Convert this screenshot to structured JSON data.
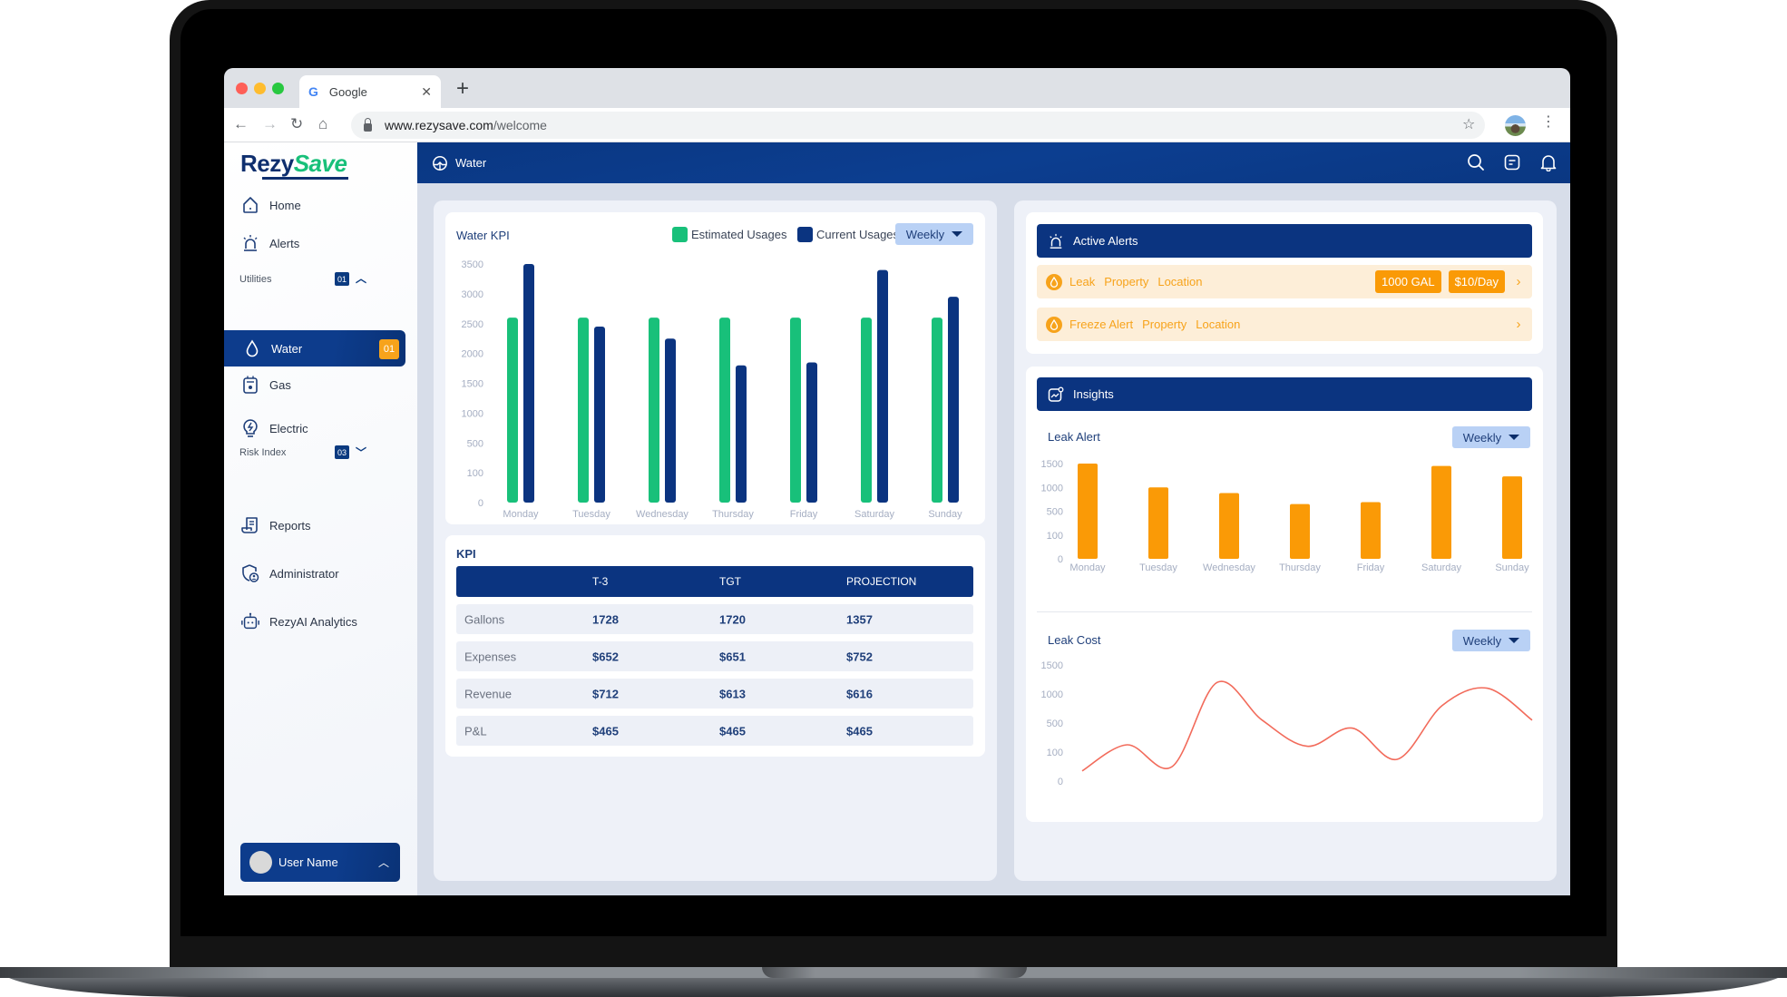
{
  "browser": {
    "tab_title": "Google",
    "tab_favicon": "G",
    "url_host": "www.rezysave.com",
    "url_path": "/welcome"
  },
  "logo": {
    "part1": "Rezy",
    "part2": "Save"
  },
  "sidebar": {
    "items_top": [
      {
        "label": "Home",
        "icon": "home-icon"
      },
      {
        "label": "Alerts",
        "icon": "siren-icon"
      }
    ],
    "utilities": {
      "label": "Utilities",
      "count": "01",
      "items": [
        {
          "label": "Water",
          "icon": "water-drop-icon",
          "badge": "01",
          "active": true
        },
        {
          "label": "Gas",
          "icon": "gas-meter-icon"
        },
        {
          "label": "Electric",
          "icon": "electric-bulb-icon"
        }
      ]
    },
    "risk_index": {
      "label": "Risk Index",
      "count": "03",
      "items": [
        {
          "label": "Reports",
          "icon": "report-icon"
        },
        {
          "label": "Administrator",
          "icon": "admin-shield-icon"
        },
        {
          "label": "RezyAI Analytics",
          "icon": "robot-icon"
        }
      ]
    },
    "user": {
      "name": "User Name"
    }
  },
  "topbar": {
    "title": "Water"
  },
  "water_kpi": {
    "title": "Water KPI",
    "dropdown": "Weekly"
  },
  "kpi_table": {
    "title": "KPI",
    "columns": [
      "",
      "T-3",
      "TGT",
      "PROJECTION"
    ],
    "rows": [
      [
        "Gallons",
        "1728",
        "1720",
        "1357"
      ],
      [
        "Expenses",
        "$652",
        "$651",
        "$752"
      ],
      [
        "Revenue",
        "$712",
        "$613",
        "$616"
      ],
      [
        "P&L",
        "$465",
        "$465",
        "$465"
      ]
    ]
  },
  "active_alerts": {
    "title": "Active Alerts",
    "items": [
      {
        "type": "Leak",
        "property": "Property",
        "location": "Location",
        "pills": [
          "1000 GAL",
          "$10/Day"
        ]
      },
      {
        "type": "Freeze Alert",
        "property": "Property",
        "location": "Location",
        "pills": []
      }
    ]
  },
  "insights": {
    "title": "Insights",
    "leak_alert": {
      "title": "Leak Alert",
      "dropdown": "Weekly"
    },
    "leak_cost": {
      "title": "Leak Cost",
      "dropdown": "Weekly"
    }
  },
  "colors": {
    "navy": "#0b3480",
    "green": "#18c07a",
    "orange": "#fa9a06",
    "line_red": "#f26b5b",
    "alert_bg": "#fdeed8"
  },
  "chart_data": [
    {
      "id": "water-kpi",
      "type": "bar",
      "title": "Water KPI",
      "categories": [
        "Monday",
        "Tuesday",
        "Wednesday",
        "Thursday",
        "Friday",
        "Saturday",
        "Sunday"
      ],
      "series": [
        {
          "name": "Estimated Usages",
          "color": "#18c07a",
          "values": [
            2600,
            2600,
            2600,
            2600,
            2600,
            2600,
            2600
          ]
        },
        {
          "name": "Current Usages",
          "color": "#0b3480",
          "values": [
            3500,
            2450,
            2250,
            1800,
            1850,
            3400,
            2950
          ]
        }
      ],
      "yticks": [
        0,
        100,
        500,
        1000,
        1500,
        2000,
        2500,
        3000,
        3500
      ],
      "ylim": [
        0,
        3500
      ],
      "legend": "top-right",
      "grid": false
    },
    {
      "id": "leak-alert",
      "type": "bar",
      "title": "Leak Alert",
      "categories": [
        "Monday",
        "Tuesday",
        "Wednesday",
        "Thursday",
        "Friday",
        "Saturday",
        "Sunday"
      ],
      "series": [
        {
          "name": "Leak Alert",
          "color": "#fa9a06",
          "values": [
            1500,
            1000,
            880,
            650,
            690,
            1450,
            1230
          ]
        }
      ],
      "yticks": [
        0,
        100,
        500,
        1000,
        1500
      ],
      "ylim": [
        0,
        1500
      ],
      "grid": false
    },
    {
      "id": "leak-cost",
      "type": "line",
      "title": "Leak Cost",
      "x": [
        0,
        1,
        2,
        3,
        4,
        5,
        6,
        7,
        8,
        9,
        10
      ],
      "series": [
        {
          "name": "Leak Cost",
          "color": "#f26b5b",
          "values": [
            35,
            200,
            50,
            1200,
            550,
            180,
            430,
            75,
            800,
            1100,
            550
          ]
        }
      ],
      "yticks": [
        0,
        100,
        500,
        1000,
        1500
      ],
      "ylim": [
        0,
        1500
      ],
      "grid": false
    }
  ]
}
